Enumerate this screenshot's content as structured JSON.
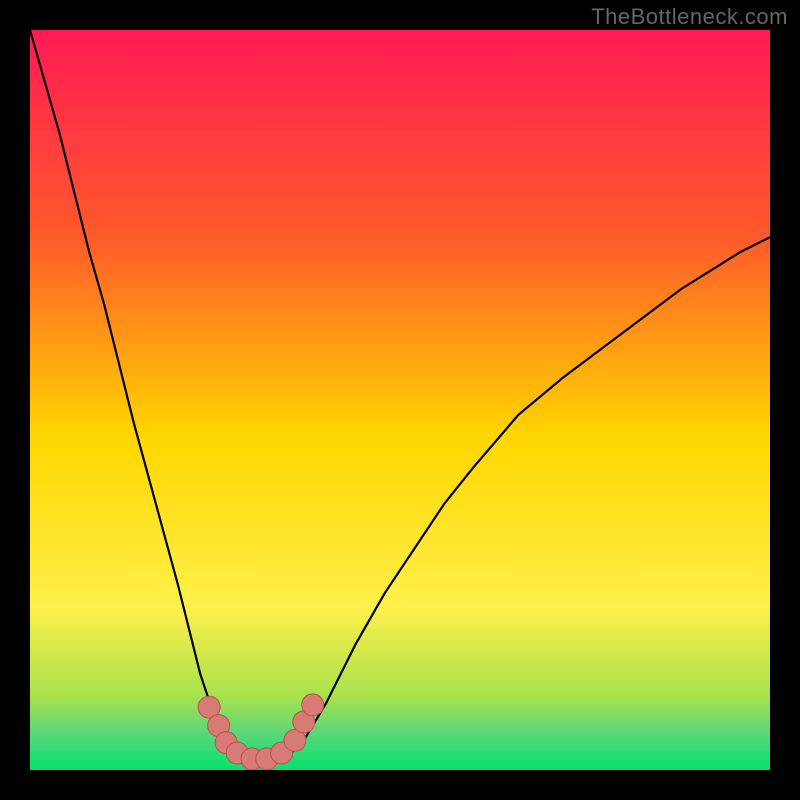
{
  "watermark": "TheBottleneck.com",
  "colors": {
    "bg": "#000000",
    "grad_top": "#ff1a55",
    "grad_upper": "#ff5a2a",
    "grad_mid": "#ffd600",
    "grad_lower": "#fff04a",
    "grad_band1": "#a8e24d",
    "grad_band2": "#5cd67a",
    "grad_bottom": "#00e36e",
    "curve": "#000000",
    "marker_fill": "#d77b74",
    "marker_stroke": "#b55650"
  },
  "chart_data": {
    "type": "line",
    "title": "",
    "xlabel": "",
    "ylabel": "",
    "x": [
      0.0,
      0.02,
      0.04,
      0.06,
      0.08,
      0.1,
      0.12,
      0.14,
      0.17,
      0.2,
      0.23,
      0.25,
      0.27,
      0.29,
      0.31,
      0.33,
      0.35,
      0.37,
      0.4,
      0.44,
      0.48,
      0.52,
      0.56,
      0.6,
      0.66,
      0.72,
      0.8,
      0.88,
      0.96,
      1.0
    ],
    "y": [
      1.0,
      0.93,
      0.86,
      0.78,
      0.7,
      0.63,
      0.55,
      0.47,
      0.36,
      0.25,
      0.13,
      0.07,
      0.04,
      0.02,
      0.01,
      0.01,
      0.02,
      0.04,
      0.09,
      0.17,
      0.24,
      0.3,
      0.36,
      0.41,
      0.48,
      0.53,
      0.59,
      0.65,
      0.7,
      0.72
    ],
    "remarks": "Axes are unlabeled in the image; x and y are normalized 0..1 to the plot box with y=0 at the bottom. Values read off the curve shape by visual estimation.",
    "markers": [
      {
        "x": 0.242,
        "y": 0.085
      },
      {
        "x": 0.255,
        "y": 0.06
      },
      {
        "x": 0.265,
        "y": 0.037
      },
      {
        "x": 0.28,
        "y": 0.023
      },
      {
        "x": 0.3,
        "y": 0.015
      },
      {
        "x": 0.32,
        "y": 0.015
      },
      {
        "x": 0.34,
        "y": 0.023
      },
      {
        "x": 0.358,
        "y": 0.04
      },
      {
        "x": 0.37,
        "y": 0.065
      },
      {
        "x": 0.382,
        "y": 0.088
      }
    ],
    "xlim": [
      0,
      1
    ],
    "ylim": [
      0,
      1
    ]
  }
}
